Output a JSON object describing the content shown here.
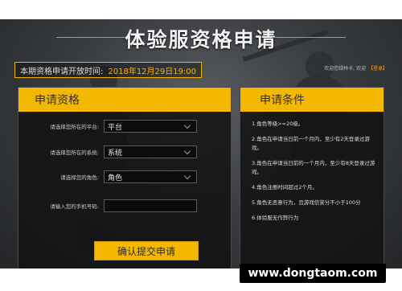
{
  "page": {
    "title": "体验服资格申请",
    "open_time_label": "本期资格申请开放时间:",
    "open_time_value": "2018年12月29日19:00",
    "welcome_text": "欢迎您绿林卡, 欢迎",
    "logout_label": "【登录】"
  },
  "apply_panel": {
    "heading": "申请资格",
    "fields": [
      {
        "label": "请选择您所在的平台:",
        "value": "平台"
      },
      {
        "label": "请选择您所在的系统:",
        "value": "系统"
      },
      {
        "label": "请选择您的角色:",
        "value": "角色"
      },
      {
        "label": "请输入您的手机号码:",
        "value": ""
      }
    ],
    "submit_label": "确认提交申请"
  },
  "conditions_panel": {
    "heading": "申请条件",
    "items": [
      "1.角色等级>=20级。",
      "2.角色在申请当日前一个月内，至少有2天登录过游戏。",
      "3.角色在申请当日前的一个月内，至少有8天登录过游戏。",
      "4.角色注册时间超过2个月。",
      "5.角色无恶意行为，且游戏信誉分不小于100分",
      "6.体验服无作弊行为"
    ]
  },
  "watermark": "www.dongtaom.com",
  "colors": {
    "accent": "#f5b800",
    "panel_bg": "#121214",
    "text": "#dddddd"
  }
}
